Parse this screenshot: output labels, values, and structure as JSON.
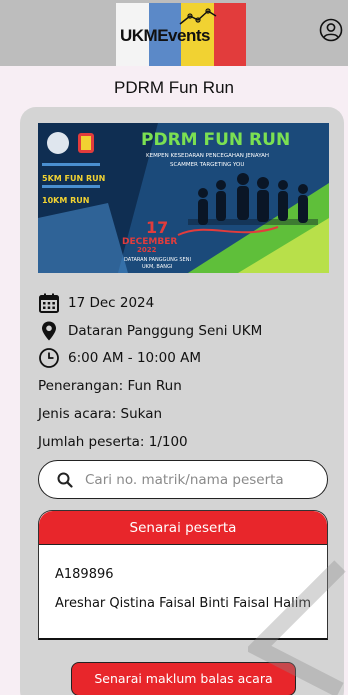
{
  "header": {
    "logo_text": "UKMEvents",
    "profile_icon": "user-circle-icon"
  },
  "page": {
    "title": "PDRM Fun Run"
  },
  "event": {
    "banner": {
      "title": "PDRM FUN RUN",
      "subtitle_line1": "KEMPEN KESEDARAN PENCEGAHAN JENAYAH",
      "subtitle_line2": "SCAMMER TARGETING YOU",
      "label_5km": "5KM FUN RUN",
      "label_10km": "10KM RUN",
      "date_day": "17",
      "date_month": "DECEMBER",
      "date_year": "2022",
      "venue_line1": "DATARAN PANGGUNG SENI",
      "venue_line2": "UKM, BANGI"
    },
    "date": "17 Dec 2024",
    "location": "Dataran Panggung Seni UKM",
    "time": "6:00 AM - 10:00 AM",
    "description": "Penerangan: Fun Run",
    "type": "Jenis acara: Sukan",
    "participants": "Jumlah peserta: 1/100"
  },
  "search": {
    "placeholder": "Cari no. matrik/nama peserta",
    "value": ""
  },
  "participant_list": {
    "header": "Senarai peserta",
    "items": [
      {
        "id": "A189896",
        "name": "Areshar Qistina Faisal Binti Faisal Halim"
      }
    ]
  },
  "feedback_button": {
    "label": "Senarai maklum balas acara"
  },
  "colors": {
    "accent_red": "#e8262b",
    "header_gray": "#bdbdbd",
    "card_gray": "#d4d4d4",
    "page_bg": "#f7eef4"
  }
}
